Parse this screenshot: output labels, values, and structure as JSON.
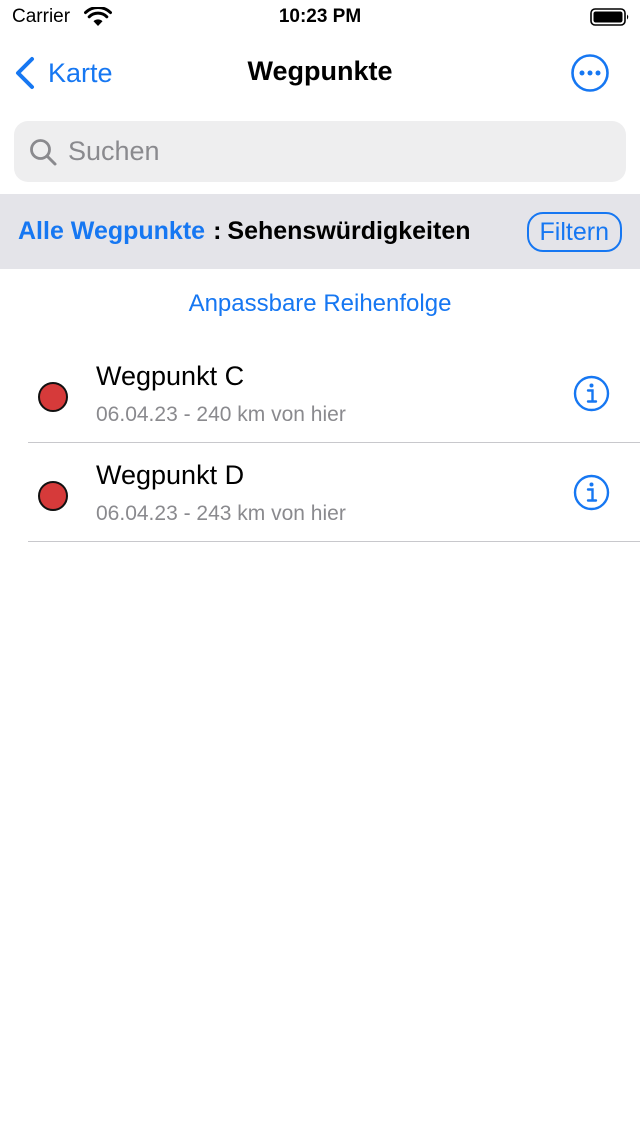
{
  "status_bar": {
    "carrier": "Carrier",
    "time": "10:23 PM"
  },
  "nav": {
    "back_label": "Karte",
    "title": "Wegpunkte"
  },
  "search": {
    "placeholder": "Suchen",
    "value": ""
  },
  "filter": {
    "all_label": "Alle Wegpunkte",
    "separator": ":",
    "category": "Sehenswürdigkeiten",
    "button_label": "Filtern"
  },
  "sort_label": "Anpassbare Reihenfolge",
  "waypoints": [
    {
      "title": "Wegpunkt C",
      "subtitle": "06.04.23 - 240 km von hier",
      "color": "#d63a3a"
    },
    {
      "title": "Wegpunkt D",
      "subtitle": "06.04.23 - 243 km von hier",
      "color": "#d63a3a"
    }
  ],
  "colors": {
    "accent": "#1677f2",
    "marker": "#d63a3a",
    "filter_bar_bg": "#e4e4e9",
    "search_bg": "#eeeeef"
  },
  "icons": {
    "back": "chevron-left-icon",
    "more": "ellipsis-circle-icon",
    "search": "magnifier-icon",
    "info": "info-circle-icon",
    "wifi": "wifi-icon",
    "battery": "battery-icon"
  }
}
